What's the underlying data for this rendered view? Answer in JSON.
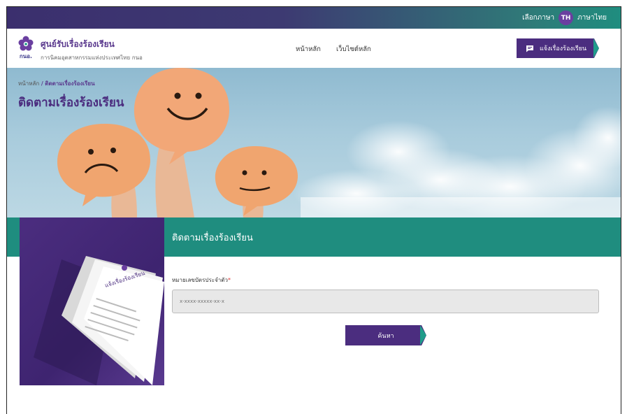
{
  "topbar": {
    "lang_label": "เลือกภาษา",
    "lang_code": "TH",
    "lang_name": "ภาษาไทย"
  },
  "brand": {
    "title": "ศูนย์รับเรื่องร้องเรียน",
    "subtitle": "การนิคมอุตสาหกรรมแห่งประเทศไทย กนอ",
    "logo_text": "กนอ."
  },
  "nav": {
    "items": [
      {
        "label": "หน้าหลัก"
      },
      {
        "label": "เว็บไซต์หลัก"
      }
    ]
  },
  "header": {
    "report_button": "แจ้งเรื่องร้องเรียน",
    "report_icon": "message-icon"
  },
  "breadcrumb": {
    "home": "หน้าหลัก",
    "separator": "/",
    "current": "ติดตามเรื่องร้องเรียน"
  },
  "hero": {
    "title": "ติดตามเรื่องร้องเรียน"
  },
  "section": {
    "title": "ติดตามเรื่องร้องเรียน"
  },
  "document_image": {
    "heading": "แจ้งเรื่องร้องเรียน"
  },
  "form": {
    "id_label": "หมายเลขบัตรประจำตัว",
    "required_mark": "*",
    "id_placeholder": "x-xxxx-xxxxx-xx-x",
    "search_button": "ค้นหา"
  },
  "colors": {
    "purple": "#4b2d7f",
    "teal": "#1f8d7f",
    "accent": "#1f9c8a"
  }
}
